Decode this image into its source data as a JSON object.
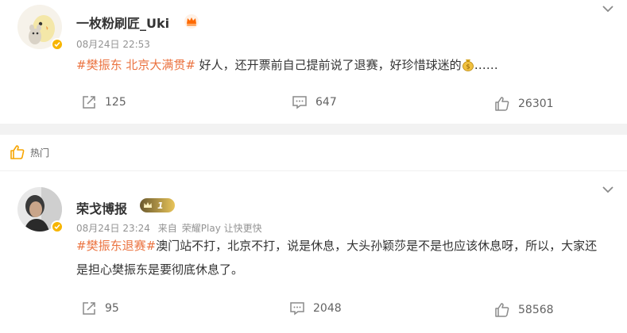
{
  "posts": [
    {
      "username": "一枚粉刷匠_Uki",
      "time": "08月24日 22:53",
      "source": "",
      "tag": "#樊振东 北京大满贯#",
      "text": " 好人，还开票前自己提前说了退赛，好珍惜球迷的",
      "trailing": "……",
      "repost_count": "125",
      "comment_count": "647",
      "like_count": "26301"
    },
    {
      "section_label": "热门",
      "username": "荣戈博报",
      "badge_level": "1",
      "time": "08月24日 23:24",
      "source_prefix": "来自",
      "source": "荣耀Play 让快更快",
      "tag": "#樊振东退赛#",
      "text": "澳门站不打，北京不打，说是休息，大头孙颖莎是不是也应该休息呀，所以，大家还是担心樊振东是要彻底休息了。",
      "repost_count": "95",
      "comment_count": "2048",
      "like_count": "58568"
    }
  ],
  "colors": {
    "accent": "#eb7340",
    "meta": "#939393",
    "verified": "#f7b500"
  },
  "icons": [
    "chevron-down-icon",
    "verified-icon",
    "money-bag-icon",
    "repost-icon",
    "comment-icon",
    "like-icon",
    "hot-icon",
    "vip-crown-icon",
    "level-badge-icon"
  ]
}
